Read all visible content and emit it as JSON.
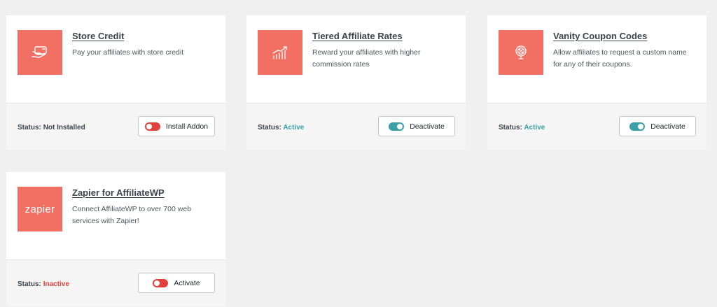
{
  "colors": {
    "accent_tile": "#f27063",
    "active": "#3a9fa6",
    "inactive": "#e2413b"
  },
  "addons": [
    {
      "title": "Store Credit",
      "description": "Pay your affiliates with store credit",
      "icon": "store-credit-icon",
      "status_label": "Status:",
      "status_value": "Not Installed",
      "button_label": "Install Addon",
      "toggle": "off"
    },
    {
      "title": "Tiered Affiliate Rates",
      "description": "Reward your affiliates with higher commission rates",
      "icon": "bar-chart-icon",
      "status_label": "Status:",
      "status_value": "Active",
      "button_label": "Deactivate",
      "toggle": "on"
    },
    {
      "title": "Vanity Coupon Codes",
      "description": "Allow affiliates to request a custom name for any of their coupons.",
      "icon": "coupon-badge-icon",
      "status_label": "Status:",
      "status_value": "Active",
      "button_label": "Deactivate",
      "toggle": "on"
    },
    {
      "title": "Zapier for AffiliateWP",
      "description": "Connect AffiliateWP to over 700 web services with Zapier!",
      "icon": "zapier-logo",
      "logo_text": "zapier",
      "status_label": "Status:",
      "status_value": "Inactive",
      "button_label": "Activate",
      "toggle": "off"
    }
  ]
}
